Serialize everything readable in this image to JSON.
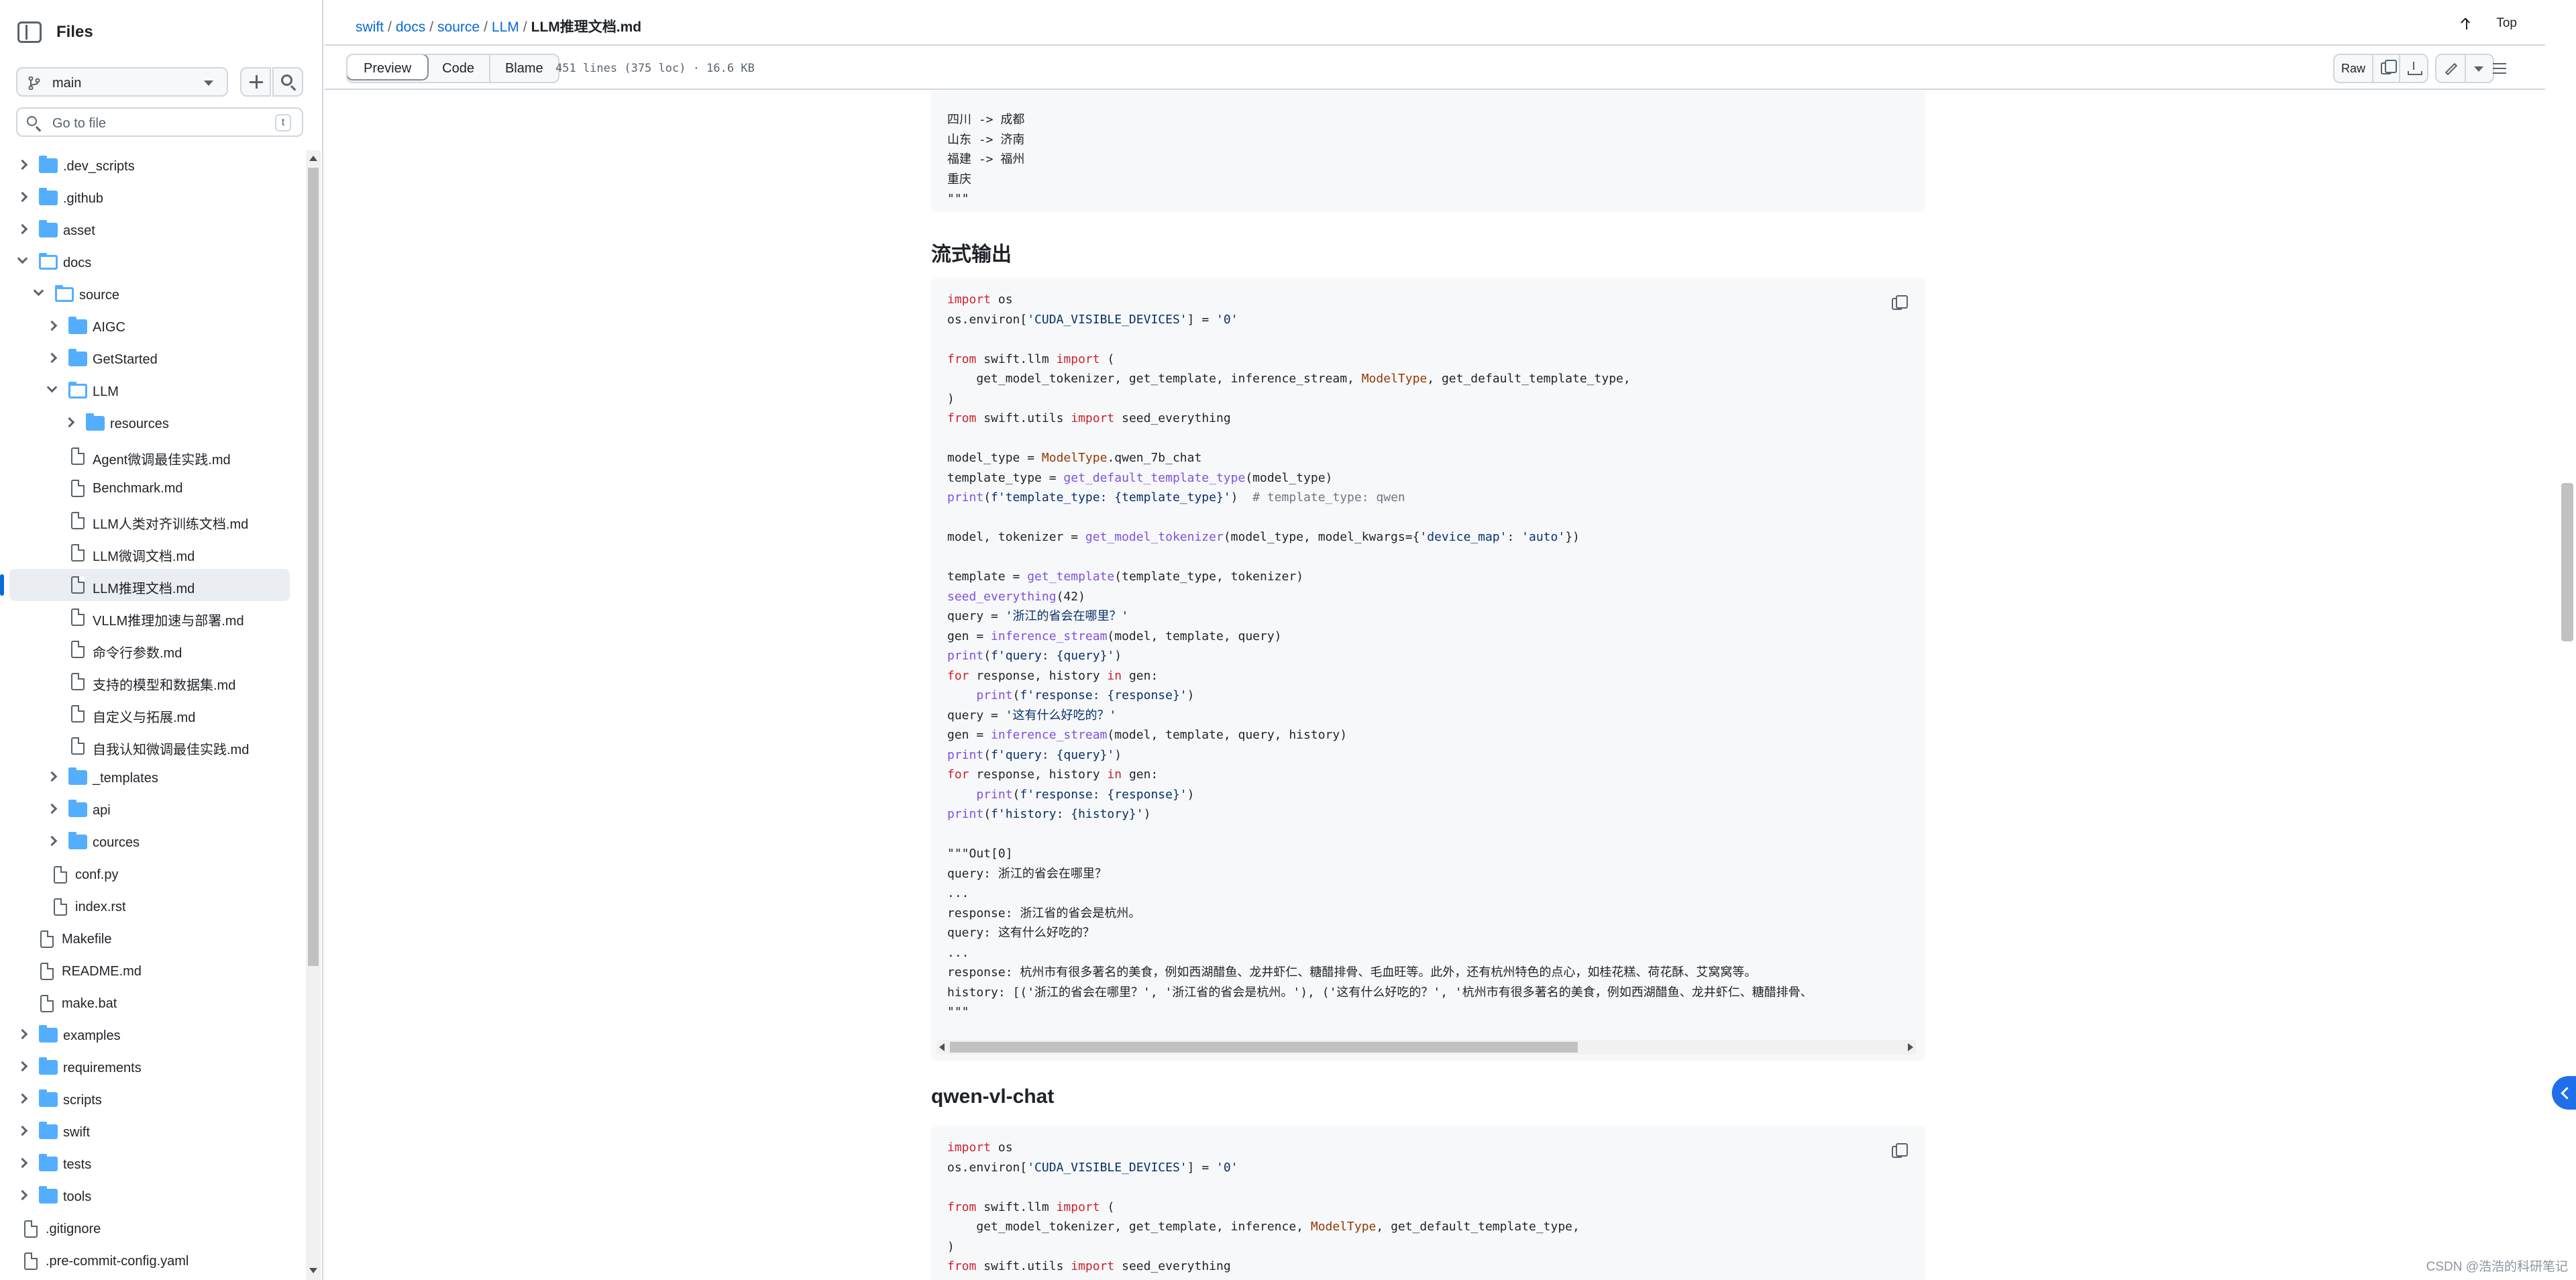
{
  "sidebar": {
    "title": "Files",
    "branch": "main",
    "goto_placeholder": "Go to file",
    "goto_shortcut": "t",
    "tree": [
      {
        "label": ".dev_scripts",
        "type": "folder",
        "depth": 0,
        "expanded": false
      },
      {
        "label": ".github",
        "type": "folder",
        "depth": 0,
        "expanded": false
      },
      {
        "label": "asset",
        "type": "folder",
        "depth": 0,
        "expanded": false
      },
      {
        "label": "docs",
        "type": "folder",
        "depth": 0,
        "expanded": true
      },
      {
        "label": "source",
        "type": "folder",
        "depth": 1,
        "expanded": true
      },
      {
        "label": "AIGC",
        "type": "folder",
        "depth": 2,
        "expanded": false
      },
      {
        "label": "GetStarted",
        "type": "folder",
        "depth": 2,
        "expanded": false
      },
      {
        "label": "LLM",
        "type": "folder",
        "depth": 2,
        "expanded": true
      },
      {
        "label": "resources",
        "type": "folder",
        "depth": 3,
        "expanded": false
      },
      {
        "label": "Agent微调最佳实践.md",
        "type": "file",
        "depth": 3
      },
      {
        "label": "Benchmark.md",
        "type": "file",
        "depth": 3
      },
      {
        "label": "LLM人类对齐训练文档.md",
        "type": "file",
        "depth": 3
      },
      {
        "label": "LLM微调文档.md",
        "type": "file",
        "depth": 3
      },
      {
        "label": "LLM推理文档.md",
        "type": "file",
        "depth": 3,
        "active": true
      },
      {
        "label": "VLLM推理加速与部署.md",
        "type": "file",
        "depth": 3
      },
      {
        "label": "命令行参数.md",
        "type": "file",
        "depth": 3
      },
      {
        "label": "支持的模型和数据集.md",
        "type": "file",
        "depth": 3
      },
      {
        "label": "自定义与拓展.md",
        "type": "file",
        "depth": 3
      },
      {
        "label": "自我认知微调最佳实践.md",
        "type": "file",
        "depth": 3
      },
      {
        "label": "_templates",
        "type": "folder",
        "depth": 2,
        "expanded": false
      },
      {
        "label": "api",
        "type": "folder",
        "depth": 2,
        "expanded": false
      },
      {
        "label": "cources",
        "type": "folder",
        "depth": 2,
        "expanded": false
      },
      {
        "label": "conf.py",
        "type": "file",
        "depth": 2
      },
      {
        "label": "index.rst",
        "type": "file",
        "depth": 2
      },
      {
        "label": "Makefile",
        "type": "file",
        "depth": 1
      },
      {
        "label": "README.md",
        "type": "file",
        "depth": 1
      },
      {
        "label": "make.bat",
        "type": "file",
        "depth": 1
      },
      {
        "label": "examples",
        "type": "folder",
        "depth": 0,
        "expanded": false
      },
      {
        "label": "requirements",
        "type": "folder",
        "depth": 0,
        "expanded": false
      },
      {
        "label": "scripts",
        "type": "folder",
        "depth": 0,
        "expanded": false
      },
      {
        "label": "swift",
        "type": "folder",
        "depth": 0,
        "expanded": false
      },
      {
        "label": "tests",
        "type": "folder",
        "depth": 0,
        "expanded": false
      },
      {
        "label": "tools",
        "type": "folder",
        "depth": 0,
        "expanded": false
      },
      {
        "label": ".gitignore",
        "type": "file",
        "depth": 0
      },
      {
        "label": ".pre-commit-config.yaml",
        "type": "file",
        "depth": 0
      }
    ]
  },
  "header": {
    "breadcrumb": [
      "swift",
      "docs",
      "source",
      "LLM"
    ],
    "current_file": "LLM推理文档.md",
    "top_label": "Top"
  },
  "toolbar": {
    "tabs": [
      "Preview",
      "Code",
      "Blame"
    ],
    "active_tab": "Preview",
    "file_meta": "451 lines (375 loc) · 16.6 KB",
    "raw_label": "Raw"
  },
  "content": {
    "block0_lines": [
      "四川 -> 成都",
      "山东 -> 济南",
      "福建 -> 福州",
      "重庆",
      "\"\"\""
    ],
    "heading1": "流式输出",
    "heading2": "qwen-vl-chat",
    "block1_lines": [
      "import os",
      "os.environ['CUDA_VISIBLE_DEVICES'] = '0'",
      "",
      "from swift.llm import (",
      "    get_model_tokenizer, get_template, inference_stream, ModelType, get_default_template_type,",
      ")",
      "from swift.utils import seed_everything",
      "",
      "model_type = ModelType.qwen_7b_chat",
      "template_type = get_default_template_type(model_type)",
      "print(f'template_type: {template_type}')  # template_type: qwen",
      "",
      "model, tokenizer = get_model_tokenizer(model_type, model_kwargs={'device_map': 'auto'})",
      "",
      "template = get_template(template_type, tokenizer)",
      "seed_everything(42)",
      "query = '浙江的省会在哪里？'",
      "gen = inference_stream(model, template, query)",
      "print(f'query: {query}')",
      "for response, history in gen:",
      "    print(f'response: {response}')",
      "query = '这有什么好吃的？'",
      "gen = inference_stream(model, template, query, history)",
      "print(f'query: {query}')",
      "for response, history in gen:",
      "    print(f'response: {response}')",
      "print(f'history: {history}')",
      "",
      "\"\"\"Out[0]",
      "query: 浙江的省会在哪里？",
      "...",
      "response: 浙江省的省会是杭州。",
      "query: 这有什么好吃的？",
      "...",
      "response: 杭州市有很多著名的美食，例如西湖醋鱼、龙井虾仁、糖醋排骨、毛血旺等。此外，还有杭州特色的点心，如桂花糕、荷花酥、艾窝窝等。",
      "history: [('浙江的省会在哪里？', '浙江省的省会是杭州。'), ('这有什么好吃的？', '杭州市有很多著名的美食，例如西湖醋鱼、龙井虾仁、糖醋排骨、",
      "\"\"\""
    ],
    "block2_lines": [
      "import os",
      "os.environ['CUDA_VISIBLE_DEVICES'] = '0'",
      "",
      "from swift.llm import (",
      "    get_model_tokenizer, get_template, inference, ModelType, get_default_template_type,",
      ")",
      "from swift.utils import seed_everything"
    ]
  },
  "watermark": "CSDN @浩浩的科研笔记",
  "colors": {
    "accent": "#0969da",
    "folder": "#54aeff",
    "keyword": "#cf222e",
    "function": "#8250df",
    "string": "#0a3069"
  }
}
